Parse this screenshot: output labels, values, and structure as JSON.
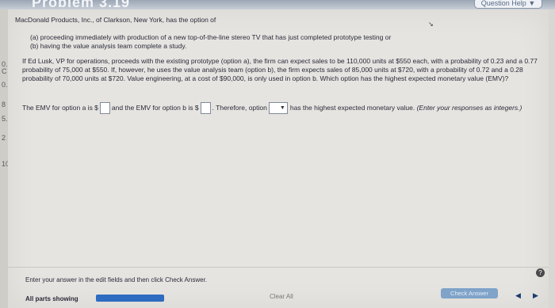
{
  "header": {
    "title": "Problem 3.19",
    "help_button": "Question Help",
    "help_arrow": "▼"
  },
  "left_fragments": [
    "C",
    "0.",
    "0.",
    "8",
    "5.",
    "2",
    "10"
  ],
  "problem": {
    "intro": "MacDonald Products, Inc., of Clarkson, New York, has the option of",
    "option_a": "(a) proceeding immediately with production of a new top-of-the-line stereo TV that has just completed prototype testing or",
    "option_b": "(b) having the value analysis team complete a study.",
    "paragraph": "If Ed Lusk, VP for operations, proceeds with the existing prototype (option a), the firm can expect sales to be 110,000 units at $550 each, with a probability of 0.23 and a 0.77 probability of 75,000 at $550. If, however, he uses the value analysis team (option b), the firm expects sales of 85,000 units at $720, with a probability of 0.72 and a 0.28 probability of 70,000 units at $720. Value engineering, at a cost of $90,000, is only used in option b. Which option has the highest expected monetary value (EMV)?"
  },
  "answer": {
    "part1": "The EMV for option a is $",
    "part2": "and the EMV for option b is $",
    "part3": ". Therefore, option",
    "part4": "has the highest expected monetary value.",
    "hint": "(Enter your responses as integers.)",
    "emv_a_value": "",
    "emv_b_value": "",
    "option_selected": "",
    "select_arrow": "▼"
  },
  "footer": {
    "instruction": "Enter your answer in the edit fields and then click Check Answer.",
    "status": "All parts showing",
    "progress": 1.0,
    "clear_all": "Clear All",
    "check_answer": "Check Answer",
    "prev": "◀",
    "next": "▶",
    "help_icon": "?"
  }
}
